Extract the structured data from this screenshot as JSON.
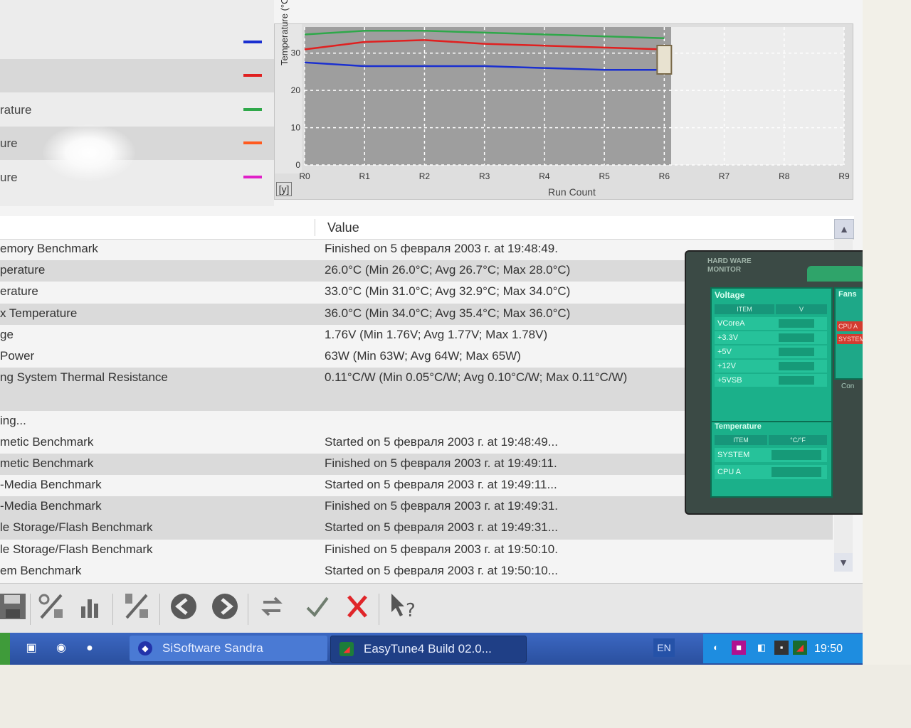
{
  "legend": {
    "items": [
      {
        "label": "",
        "color": "#1a2fd0"
      },
      {
        "label": "",
        "color": "#e02020"
      },
      {
        "label": "rature",
        "color": "#2fa84a"
      },
      {
        "label": "ure",
        "color": "#ff5a1f"
      },
      {
        "label": "ure",
        "color": "#e020c8"
      }
    ]
  },
  "chart_data": {
    "type": "line",
    "ylabel": "Temperature (°C)",
    "xlabel": "Run Count",
    "categories": [
      "R0",
      "R1",
      "R2",
      "R3",
      "R4",
      "R5",
      "R6",
      "R7",
      "R8",
      "R9"
    ],
    "yticks": [
      "0",
      "10",
      "20",
      "30"
    ],
    "ylim": [
      0,
      37
    ],
    "y_axis_button": "[y]",
    "series": [
      {
        "color": "#2fa84a",
        "values": [
          35.0,
          36.0,
          36.0,
          35.5,
          35.0,
          34.5,
          34.0
        ]
      },
      {
        "color": "#e02020",
        "values": [
          31.0,
          33.0,
          33.5,
          32.5,
          32.0,
          31.5,
          31.0
        ]
      },
      {
        "color": "#1a2fd0",
        "values": [
          27.5,
          26.5,
          26.5,
          26.5,
          26.0,
          25.5,
          25.5
        ]
      }
    ],
    "grid": true
  },
  "table": {
    "header_value": "Value",
    "rows": [
      {
        "label": "emory Benchmark",
        "value": "Finished on 5 февраля 2003 г. at 19:48:49."
      },
      {
        "label": "perature",
        "value": "26.0°C (Min 26.0°C; Avg 26.7°C; Max 28.0°C)"
      },
      {
        "label": "erature",
        "value": "33.0°C (Min 31.0°C; Avg 32.9°C; Max 34.0°C)"
      },
      {
        "label": "x Temperature",
        "value": "36.0°C (Min 34.0°C; Avg 35.4°C; Max 36.0°C)"
      },
      {
        "label": "ge",
        "value": "1.76V (Min 1.76V; Avg 1.77V; Max 1.78V)"
      },
      {
        "label": "Power",
        "value": "63W (Min 63W; Avg 64W; Max 65W)"
      },
      {
        "label": "ng System Thermal Resistance",
        "value": "0.11°C/W (Min 0.05°C/W; Avg 0.10°C/W; Max 0.11°C/W)"
      },
      {
        "label": "",
        "value": ""
      },
      {
        "label": "ing...",
        "value": ""
      },
      {
        "label": "metic Benchmark",
        "value": "Started on 5 февраля 2003 г. at 19:48:49..."
      },
      {
        "label": "metic Benchmark",
        "value": "Finished on 5 февраля 2003 г. at 19:49:11."
      },
      {
        "label": "-Media Benchmark",
        "value": "Started on 5 февраля 2003 г. at 19:49:11..."
      },
      {
        "label": "-Media Benchmark",
        "value": "Finished on 5 февраля 2003 г. at 19:49:31."
      },
      {
        "label": "le Storage/Flash Benchmark",
        "value": "Started on 5 февраля 2003 г. at 19:49:31..."
      },
      {
        "label": "le Storage/Flash Benchmark",
        "value": "Finished on 5 февраля 2003 г. at 19:50:10."
      },
      {
        "label": "em Benchmark",
        "value": "Started on 5 февраля 2003 г. at 19:50:10..."
      }
    ]
  },
  "hw_monitor": {
    "title": "HARD WARE MONITOR",
    "voltage_title": "Voltage",
    "voltage_col_item": "ITEM",
    "voltage_col_v": "V",
    "voltage_items": [
      "VCoreA",
      "+3.3V",
      "+5V",
      "+12V",
      "+5VSB"
    ],
    "fans_title": "Fans",
    "fan_items": [
      "CPU A",
      "SYSTEM"
    ],
    "con_label": "Con",
    "temp_title": "Temperature",
    "temp_col_item": "ITEM",
    "temp_col_unit": "°C/°F",
    "temp_items": [
      "SYSTEM",
      "CPU A"
    ]
  },
  "toolbar": {
    "icons": [
      "save-icon",
      "percent-chart-icon",
      "bar-chart-icon",
      "percent-chart-2-icon",
      "back-icon",
      "forward-icon",
      "refresh-icon",
      "ok-icon",
      "cancel-icon",
      "help-icon"
    ]
  },
  "taskbar": {
    "sandra_label": "SiSoftware Sandra",
    "easytune_label": "EasyTune4 Build 02.0...",
    "language": "EN",
    "clock": "19:50"
  }
}
